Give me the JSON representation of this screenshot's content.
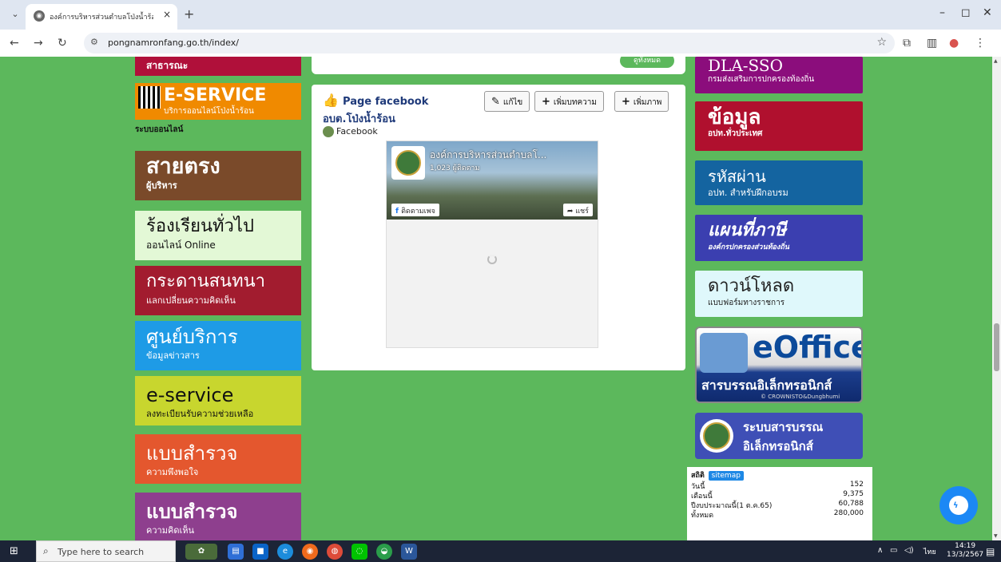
{
  "browser": {
    "tab_title": "องค์การบริหารส่วนตำบลโป่งน้ำร้อน อ.",
    "tab_close": "×",
    "new_tab": "+",
    "url": "pongnamronfang.go.th/index/",
    "win_min": "–",
    "win_max": "◻",
    "win_close": "✕"
  },
  "left_menu": [
    {
      "big": "สาธารณะ",
      "small": "",
      "color": "#b0103a"
    },
    {
      "big": "E-SERVICE",
      "small": "บริการออนไลน์โป่งน้ำร้อน",
      "small2": "ระบบออนไลน์",
      "color": "#f08a00"
    },
    {
      "big": "สายตรง",
      "small": "ผู้บริหาร",
      "color": "#7a4a2a"
    },
    {
      "big": "ร้องเรียนทั่วไป",
      "small": "ออนไลน์ Online",
      "color": "#e3f8d6"
    },
    {
      "big": "กระดานสนทนา",
      "small": "แลกเปลี่ยนความคิดเห็น",
      "color": "#a21c2f"
    },
    {
      "big": "ศูนย์บริการ",
      "small": "ข้อมูลข่าวสาร",
      "color": "#1e9be6"
    },
    {
      "big": "e-service",
      "small": "ลงทะเบียนรับความช่วยเหลือ",
      "color": "#c8d62e"
    },
    {
      "big": "แบบสำรวจ",
      "small": "ความพึงพอใจ",
      "color": "#e4572e"
    },
    {
      "big": "แบบสำรวจ",
      "small": "ความคิดเห็น",
      "color": "#8e3f8e"
    }
  ],
  "center": {
    "top_btn": "ดูทั้งหมด",
    "fb_title": "Page facebook",
    "fb_sub": "อบต.โป่งน้ำร้อน",
    "fb_source": "Facebook",
    "btn_edit": "แก้ไข",
    "btn_add_post": "เพิ่มบทความ",
    "btn_add_image": "เพิ่มภาพ",
    "page_name": "องค์การบริหารส่วนตำบลโ...",
    "followers": "1,023 ผู้ติดตาม",
    "follow": "ติดตามเพจ",
    "share": "แชร์"
  },
  "right_menu": [
    {
      "big": "DLA-SSO",
      "small": "กรมส่งเสริมการปกครองท้องถิ่น",
      "color": "#8b0d7c"
    },
    {
      "big": "ข้อมูล",
      "small": "อปท.ทั่วประเทศ",
      "color": "#b0102e"
    },
    {
      "big": "รหัสผ่าน",
      "small": "อปท. สำหรับฝึกอบรม",
      "color": "#1464a0"
    },
    {
      "big": "แผนที่ภาษี",
      "small": "องค์กรปกครองส่วนท้องถิ่น",
      "color": "#3b3fb0"
    },
    {
      "big": "ดาวน์โหลด",
      "small": "แบบฟอร์มทางราชการ",
      "color": "#dff8fb"
    }
  ],
  "eoffice": {
    "title": "eOffice",
    "sub": "สารบรรณอิเล็กทรอนิกส์",
    "credit": "© CROWNISTO&Dungbhumi"
  },
  "saraban": {
    "line1": "ระบบสารบรรณ",
    "line2": "อิเล็กทรอนิกส์"
  },
  "stats": {
    "header": "สถิติ",
    "sitemap": "sitemap",
    "rows": [
      {
        "label": "วันนี้",
        "value": "152"
      },
      {
        "label": "เดือนนี้",
        "value": "9,375"
      },
      {
        "label": "ปีงบประมาณนี้(1 ต.ค.65)",
        "value": "60,788"
      },
      {
        "label": "ทั้งหมด",
        "value": "280,000"
      }
    ]
  },
  "taskbar": {
    "search_placeholder": "Type here to search",
    "lang": "ไทย",
    "time": "14:19",
    "date": "13/3/2567"
  }
}
